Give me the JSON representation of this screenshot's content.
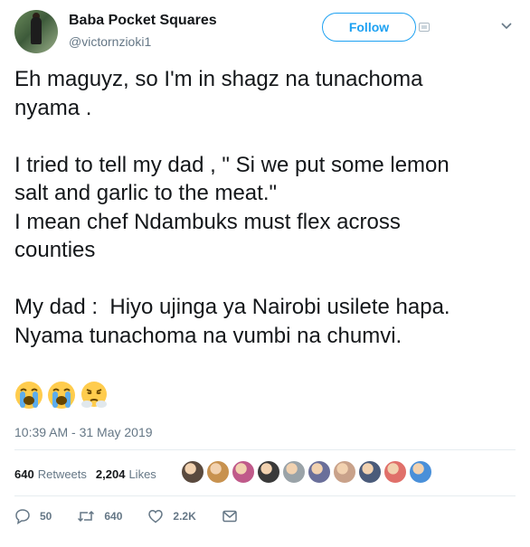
{
  "author": {
    "display_name": "Baba Pocket Squares",
    "handle": "@victornzioki1"
  },
  "follow_label": "Follow",
  "tweet": {
    "text": "Eh maguyz, so I'm in shagz na tunachoma\nnyama .\n\nI tried to tell my dad , \" Si we put some lemon\nsalt and garlic to the meat.\"\nI mean chef Ndambuks must flex across\ncounties\n\nMy dad :  Hiyo ujinga ya Nairobi usilete hapa.\nNyama tunachoma na vumbi na chumvi.",
    "emojis": [
      "loudly-crying-face",
      "loudly-crying-face",
      "face-with-steam-from-nose"
    ],
    "timestamp": "10:39 AM - 31 May 2019"
  },
  "stats": {
    "retweets_count": "640",
    "retweets_label": "Retweets",
    "likes_count": "2,204",
    "likes_label": "Likes",
    "liker_colors": [
      "#5a4a3e",
      "#c8924f",
      "#c05a8a",
      "#3a3a3a",
      "#9aa3a8",
      "#6a6f9a",
      "#c9a28a",
      "#4a5b7a",
      "#e0706a",
      "#4a90d9"
    ]
  },
  "actions": {
    "reply_count": "50",
    "retweet_count": "640",
    "like_count": "2.2K"
  },
  "colors": {
    "accent": "#1da1f2",
    "secondary_text": "#657786",
    "divider": "#e6ecf0"
  }
}
